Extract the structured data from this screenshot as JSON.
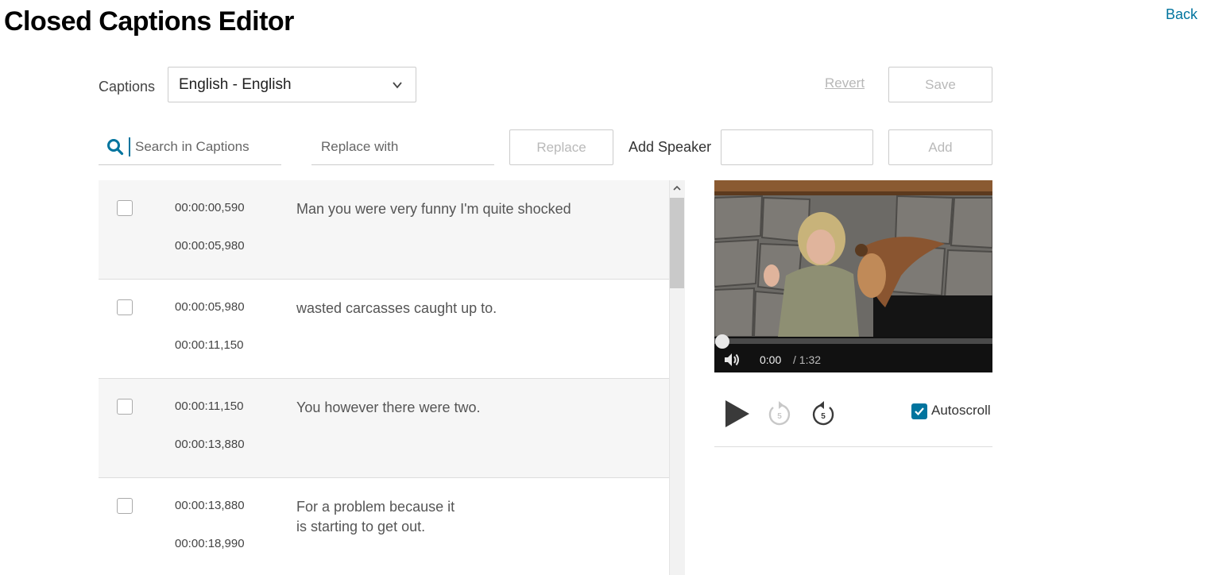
{
  "header": {
    "title": "Closed Captions Editor",
    "back_label": "Back"
  },
  "toolbar": {
    "captions_label": "Captions",
    "language_selected": "English - English",
    "revert_label": "Revert",
    "save_label": "Save"
  },
  "search": {
    "placeholder": "Search in Captions",
    "value": "",
    "replace_placeholder": "Replace with",
    "replace_label": "Replace",
    "add_speaker_label": "Add Speaker",
    "speaker_value": "",
    "add_label": "Add"
  },
  "captions": [
    {
      "start": "00:00:00,590",
      "end": "00:00:05,980",
      "text": "Man you were very funny I'm quite shocked",
      "checked": false
    },
    {
      "start": "00:00:05,980",
      "end": "00:00:11,150",
      "text": "wasted carcasses caught up to.",
      "checked": false
    },
    {
      "start": "00:00:11,150",
      "end": "00:00:13,880",
      "text": "You however there were two.",
      "checked": false
    },
    {
      "start": "00:00:13,880",
      "end": "00:00:18,990",
      "text": "For a problem because it\nis starting to get out.",
      "checked": false
    }
  ],
  "player": {
    "current_time": "0:00",
    "total_time": "/ 1:32",
    "progress": 0,
    "autoscroll_label": "Autoscroll",
    "autoscroll_checked": true
  },
  "icons": {
    "search": "search-icon",
    "dropdown": "chevron-down-icon",
    "volume": "volume-icon",
    "play": "play-icon",
    "rewind": "rewind-5-icon",
    "forward": "forward-5-icon",
    "check": "checkmark-icon"
  },
  "colors": {
    "accent": "#00749e",
    "disabled_text": "#b9b9b9",
    "row_alt": "#f6f6f6"
  }
}
